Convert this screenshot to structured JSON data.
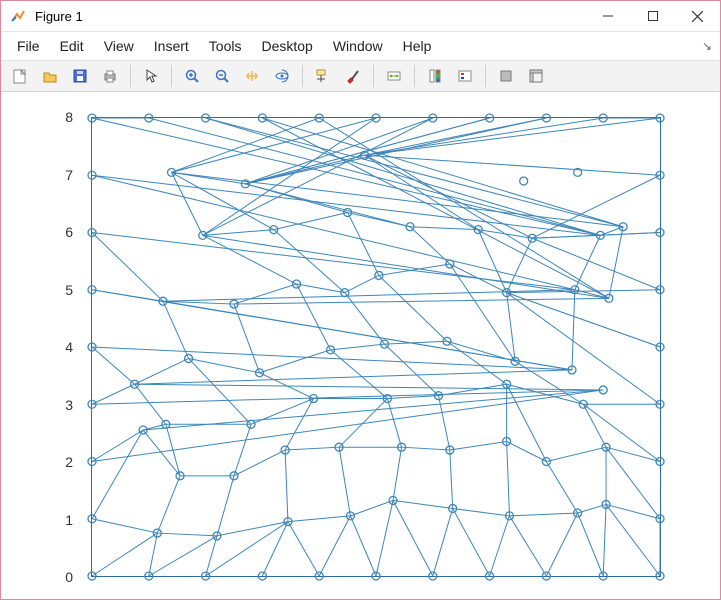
{
  "window": {
    "title": "Figure 1"
  },
  "menu": {
    "items": [
      "File",
      "Edit",
      "View",
      "Insert",
      "Tools",
      "Desktop",
      "Window",
      "Help"
    ]
  },
  "toolbar": {
    "icons": [
      "new-figure-icon",
      "open-icon",
      "save-icon",
      "print-icon",
      "sep",
      "pointer-icon",
      "sep",
      "zoom-in-icon",
      "zoom-out-icon",
      "pan-icon",
      "rotate3d-icon",
      "sep",
      "data-cursor-icon",
      "brush-icon",
      "sep",
      "link-plot-icon",
      "sep",
      "insert-colorbar-icon",
      "insert-legend-icon",
      "sep",
      "hide-plot-tools-icon",
      "show-plot-tools-icon"
    ]
  },
  "axes": {
    "xlim": [
      0,
      10
    ],
    "ylim": [
      0,
      8
    ],
    "yticks": [
      0,
      1,
      2,
      3,
      4,
      5,
      6,
      7,
      8
    ]
  },
  "chart_data": {
    "type": "scatter",
    "title": "",
    "xlabel": "",
    "ylabel": "",
    "xlim": [
      0,
      10
    ],
    "ylim": [
      0,
      8
    ],
    "nodes": [
      [
        0,
        0
      ],
      [
        1,
        0
      ],
      [
        2,
        0
      ],
      [
        3,
        0
      ],
      [
        4,
        0
      ],
      [
        5,
        0
      ],
      [
        6,
        0
      ],
      [
        7,
        0
      ],
      [
        8,
        0
      ],
      [
        9,
        0
      ],
      [
        10,
        0
      ],
      [
        0,
        1
      ],
      [
        0,
        2
      ],
      [
        0,
        3
      ],
      [
        0,
        4
      ],
      [
        0,
        5
      ],
      [
        0,
        6
      ],
      [
        0,
        7
      ],
      [
        0,
        8
      ],
      [
        10,
        1
      ],
      [
        10,
        2
      ],
      [
        10,
        3
      ],
      [
        10,
        4
      ],
      [
        10,
        5
      ],
      [
        10,
        6
      ],
      [
        10,
        7
      ],
      [
        10,
        8
      ],
      [
        1,
        8
      ],
      [
        2,
        8
      ],
      [
        3,
        8
      ],
      [
        4,
        8
      ],
      [
        5,
        8
      ],
      [
        6,
        8
      ],
      [
        7,
        8
      ],
      [
        8,
        8
      ],
      [
        9,
        8
      ],
      [
        1.15,
        0.75
      ],
      [
        2.2,
        0.7
      ],
      [
        3.45,
        0.95
      ],
      [
        4.55,
        1.05
      ],
      [
        5.3,
        1.32
      ],
      [
        6.35,
        1.18
      ],
      [
        7.35,
        1.05
      ],
      [
        8.55,
        1.1
      ],
      [
        9.05,
        1.25
      ],
      [
        1.55,
        1.75
      ],
      [
        2.5,
        1.75
      ],
      [
        3.4,
        2.2
      ],
      [
        4.35,
        2.25
      ],
      [
        5.45,
        2.25
      ],
      [
        6.3,
        2.2
      ],
      [
        7.3,
        2.35
      ],
      [
        8.0,
        2.0
      ],
      [
        9.05,
        2.25
      ],
      [
        0.9,
        2.55
      ],
      [
        1.3,
        2.65
      ],
      [
        2.8,
        2.65
      ],
      [
        3.9,
        3.1
      ],
      [
        5.2,
        3.1
      ],
      [
        6.1,
        3.15
      ],
      [
        7.3,
        3.35
      ],
      [
        8.65,
        3.0
      ],
      [
        9.0,
        3.25
      ],
      [
        0.75,
        3.35
      ],
      [
        1.7,
        3.8
      ],
      [
        2.95,
        3.55
      ],
      [
        4.2,
        3.95
      ],
      [
        5.15,
        4.05
      ],
      [
        6.25,
        4.1
      ],
      [
        7.45,
        3.75
      ],
      [
        8.45,
        3.6
      ],
      [
        1.25,
        4.8
      ],
      [
        2.5,
        4.75
      ],
      [
        3.6,
        5.1
      ],
      [
        4.45,
        4.95
      ],
      [
        5.05,
        5.25
      ],
      [
        6.3,
        5.45
      ],
      [
        7.3,
        4.95
      ],
      [
        8.5,
        5.0
      ],
      [
        9.1,
        4.85
      ],
      [
        1.95,
        5.95
      ],
      [
        3.2,
        6.05
      ],
      [
        4.5,
        6.35
      ],
      [
        5.6,
        6.1
      ],
      [
        6.8,
        6.05
      ],
      [
        7.75,
        5.9
      ],
      [
        8.95,
        5.95
      ],
      [
        9.35,
        6.1
      ],
      [
        1.4,
        7.05
      ],
      [
        2.7,
        6.85
      ],
      [
        4.8,
        7.35
      ],
      [
        7.6,
        6.9
      ],
      [
        8.55,
        7.05
      ]
    ],
    "edges": [
      [
        0,
        36
      ],
      [
        1,
        36
      ],
      [
        1,
        37
      ],
      [
        2,
        37
      ],
      [
        2,
        38
      ],
      [
        3,
        38
      ],
      [
        4,
        38
      ],
      [
        4,
        39
      ],
      [
        5,
        39
      ],
      [
        5,
        40
      ],
      [
        6,
        41
      ],
      [
        6,
        40
      ],
      [
        7,
        41
      ],
      [
        7,
        42
      ],
      [
        8,
        42
      ],
      [
        8,
        43
      ],
      [
        9,
        43
      ],
      [
        9,
        44
      ],
      [
        10,
        44
      ],
      [
        10,
        19
      ],
      [
        11,
        36
      ],
      [
        11,
        54
      ],
      [
        12,
        54
      ],
      [
        12,
        62
      ],
      [
        13,
        62
      ],
      [
        13,
        63
      ],
      [
        14,
        63
      ],
      [
        14,
        70
      ],
      [
        15,
        70
      ],
      [
        15,
        71
      ],
      [
        16,
        78
      ],
      [
        16,
        71
      ],
      [
        17,
        86
      ],
      [
        17,
        78
      ],
      [
        18,
        86
      ],
      [
        18,
        27
      ],
      [
        19,
        44
      ],
      [
        19,
        53
      ],
      [
        20,
        53
      ],
      [
        20,
        61
      ],
      [
        21,
        61
      ],
      [
        21,
        77
      ],
      [
        22,
        77
      ],
      [
        22,
        77
      ],
      [
        23,
        77
      ],
      [
        23,
        85
      ],
      [
        24,
        85
      ],
      [
        24,
        85
      ],
      [
        25,
        85
      ],
      [
        25,
        90
      ],
      [
        26,
        90
      ],
      [
        26,
        35
      ],
      [
        27,
        86
      ],
      [
        28,
        86
      ],
      [
        28,
        87
      ],
      [
        29,
        87
      ],
      [
        29,
        79
      ],
      [
        30,
        88
      ],
      [
        30,
        79
      ],
      [
        31,
        88
      ],
      [
        31,
        80
      ],
      [
        32,
        80
      ],
      [
        32,
        89
      ],
      [
        33,
        89
      ],
      [
        33,
        89
      ],
      [
        34,
        89
      ],
      [
        34,
        90
      ],
      [
        35,
        90
      ],
      [
        36,
        37
      ],
      [
        36,
        45
      ],
      [
        37,
        38
      ],
      [
        37,
        46
      ],
      [
        38,
        39
      ],
      [
        38,
        47
      ],
      [
        39,
        40
      ],
      [
        39,
        48
      ],
      [
        40,
        41
      ],
      [
        40,
        49
      ],
      [
        41,
        42
      ],
      [
        41,
        50
      ],
      [
        42,
        43
      ],
      [
        42,
        51
      ],
      [
        43,
        44
      ],
      [
        43,
        52
      ],
      [
        44,
        53
      ],
      [
        45,
        46
      ],
      [
        45,
        54
      ],
      [
        45,
        55
      ],
      [
        46,
        47
      ],
      [
        46,
        56
      ],
      [
        47,
        48
      ],
      [
        47,
        57
      ],
      [
        48,
        49
      ],
      [
        48,
        58
      ],
      [
        49,
        50
      ],
      [
        49,
        58
      ],
      [
        50,
        51
      ],
      [
        50,
        59
      ],
      [
        51,
        52
      ],
      [
        51,
        60
      ],
      [
        52,
        53
      ],
      [
        52,
        60
      ],
      [
        53,
        61
      ],
      [
        54,
        55
      ],
      [
        54,
        62
      ],
      [
        55,
        56
      ],
      [
        55,
        63
      ],
      [
        56,
        57
      ],
      [
        56,
        64
      ],
      [
        57,
        58
      ],
      [
        57,
        65
      ],
      [
        58,
        59
      ],
      [
        58,
        66
      ],
      [
        59,
        60
      ],
      [
        59,
        67
      ],
      [
        60,
        61
      ],
      [
        60,
        68
      ],
      [
        61,
        69
      ],
      [
        62,
        63
      ],
      [
        63,
        64
      ],
      [
        63,
        70
      ],
      [
        64,
        65
      ],
      [
        64,
        71
      ],
      [
        65,
        66
      ],
      [
        65,
        72
      ],
      [
        66,
        67
      ],
      [
        66,
        73
      ],
      [
        67,
        68
      ],
      [
        67,
        74
      ],
      [
        68,
        69
      ],
      [
        68,
        75
      ],
      [
        69,
        76
      ],
      [
        69,
        77
      ],
      [
        70,
        71
      ],
      [
        70,
        78
      ],
      [
        71,
        72
      ],
      [
        71,
        78
      ],
      [
        72,
        73
      ],
      [
        72,
        79
      ],
      [
        73,
        74
      ],
      [
        73,
        80
      ],
      [
        74,
        75
      ],
      [
        74,
        81
      ],
      [
        75,
        76
      ],
      [
        75,
        82
      ],
      [
        76,
        77
      ],
      [
        76,
        83
      ],
      [
        77,
        84
      ],
      [
        77,
        85
      ],
      [
        78,
        79
      ],
      [
        78,
        86
      ],
      [
        79,
        80
      ],
      [
        79,
        87
      ],
      [
        80,
        81
      ],
      [
        80,
        88
      ],
      [
        81,
        82
      ],
      [
        81,
        88
      ],
      [
        82,
        83
      ],
      [
        82,
        89
      ],
      [
        83,
        84
      ],
      [
        83,
        89
      ],
      [
        84,
        85
      ],
      [
        84,
        90
      ],
      [
        85,
        90
      ],
      [
        86,
        87
      ],
      [
        87,
        88
      ],
      [
        88,
        89
      ],
      [
        89,
        90
      ]
    ]
  }
}
